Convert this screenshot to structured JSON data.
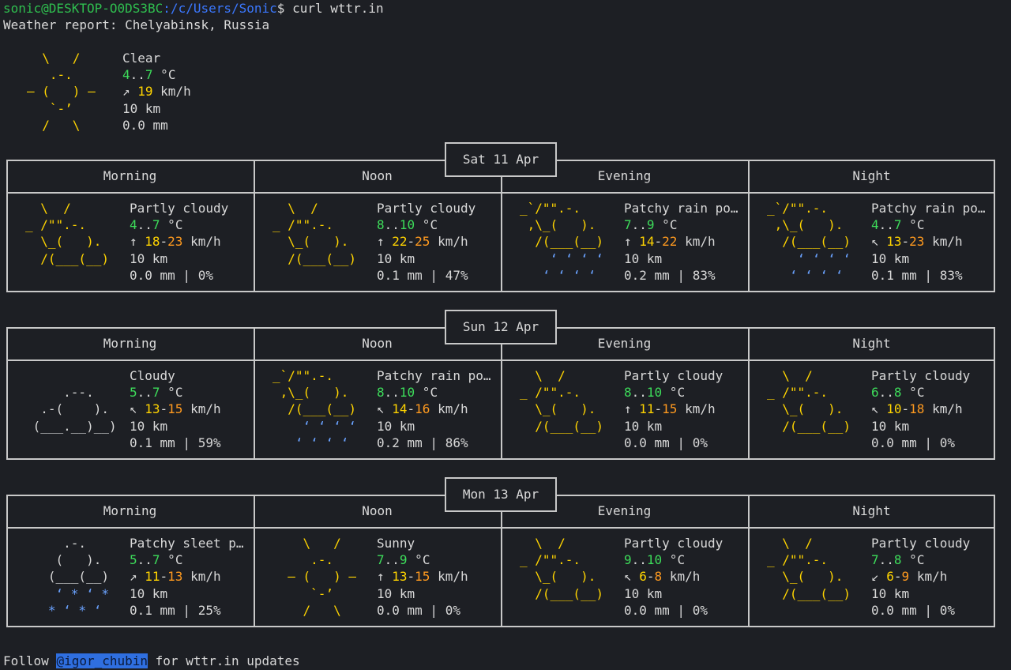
{
  "prompt": {
    "user_host": "sonic@DESKTOP-O0DS3BC",
    "path": ":/c/Users/Sonic",
    "symbol": "$ ",
    "command": "curl wttr.in"
  },
  "report_title": "Weather report: Chelyabinsk, Russia",
  "current": {
    "art": "  \\   /\n   .-.\n― (   ) ―\n   `-’\n  /   \\",
    "condition": "Clear",
    "temp_low": "4",
    "temp_high": "7",
    "temp_unit": " °C",
    "wind_arrow": "↗ ",
    "wind": "19",
    "wind_unit": " km/h",
    "visibility": "10 km",
    "precip": "0.0 mm"
  },
  "columns": [
    "Morning",
    "Noon",
    "Evening",
    "Night"
  ],
  "days": [
    {
      "date": "Sat 11 Apr",
      "periods": [
        {
          "art": "  \\  /\n_ /\"\".-.\n  \\_(   ).\n  /(___(__)",
          "condition": "Partly cloudy",
          "temp_low": "4",
          "temp_high": "7",
          "wind_arrow": "↑ ",
          "wind_low": "18",
          "wind_high": "23",
          "visibility": "10 km",
          "precip": "0.0 mm | 0%"
        },
        {
          "art": "  \\  /\n_ /\"\".-.\n  \\_(   ).\n  /(___(__)",
          "condition": "Partly cloudy",
          "temp_low": "8",
          "temp_high": "10",
          "wind_arrow": "↑ ",
          "wind_low": "22",
          "wind_high": "25",
          "visibility": "10 km",
          "precip": "0.1 mm | 47%"
        },
        {
          "art": "_`/\"\".-.\n ,\\_(   ).\n  /(___(__)\n    ‘ ‘ ‘ ‘\n   ‘ ‘ ‘ ‘",
          "condition": "Patchy rain po…",
          "temp_low": "7",
          "temp_high": "9",
          "wind_arrow": "↑ ",
          "wind_low": "14",
          "wind_high": "22",
          "visibility": "10 km",
          "precip": "0.2 mm | 83%"
        },
        {
          "art": "_`/\"\".-.\n ,\\_(   ).\n  /(___(__)\n    ‘ ‘ ‘ ‘\n   ‘ ‘ ‘ ‘",
          "condition": "Patchy rain po…",
          "temp_low": "4",
          "temp_high": "7",
          "wind_arrow": "↖ ",
          "wind_low": "13",
          "wind_high": "23",
          "visibility": "10 km",
          "precip": "0.1 mm | 83%"
        }
      ]
    },
    {
      "date": "Sun 12 Apr",
      "periods": [
        {
          "art": "\n     .--.\n  .-(    ).\n (___.__)__)",
          "condition": "Cloudy",
          "temp_low": "5",
          "temp_high": "7",
          "wind_arrow": "↖ ",
          "wind_low": "13",
          "wind_high": "15",
          "visibility": "10 km",
          "precip": "0.1 mm | 59%"
        },
        {
          "art": "_`/\"\".-.\n ,\\_(   ).\n  /(___(__)\n    ‘ ‘ ‘ ‘\n   ‘ ‘ ‘ ‘",
          "condition": "Patchy rain po…",
          "temp_low": "8",
          "temp_high": "10",
          "wind_arrow": "↖ ",
          "wind_low": "14",
          "wind_high": "16",
          "visibility": "10 km",
          "precip": "0.2 mm | 86%"
        },
        {
          "art": "  \\  /\n_ /\"\".-.\n  \\_(   ).\n  /(___(__)",
          "condition": "Partly cloudy",
          "temp_low": "8",
          "temp_high": "10",
          "wind_arrow": "↑ ",
          "wind_low": "11",
          "wind_high": "15",
          "visibility": "10 km",
          "precip": "0.0 mm | 0%"
        },
        {
          "art": "  \\  /\n_ /\"\".-.\n  \\_(   ).\n  /(___(__)",
          "condition": "Partly cloudy",
          "temp_low": "6",
          "temp_high": "8",
          "wind_arrow": "↖ ",
          "wind_low": "10",
          "wind_high": "18",
          "visibility": "10 km",
          "precip": "0.0 mm | 0%"
        }
      ]
    },
    {
      "date": "Mon 13 Apr",
      "periods": [
        {
          "art": "     .-.\n    (   ).\n   (___(__)\n    ‘ * ‘ *\n   * ‘ * ‘",
          "condition": "Patchy sleet p…",
          "temp_low": "5",
          "temp_high": "7",
          "wind_arrow": "↗ ",
          "wind_low": "11",
          "wind_high": "13",
          "visibility": "10 km",
          "precip": "0.1 mm | 25%"
        },
        {
          "art": "    \\   /\n     .-.\n  ― (   ) ―\n     `-’\n    /   \\",
          "condition": "Sunny",
          "temp_low": "7",
          "temp_high": "9",
          "wind_arrow": "↑ ",
          "wind_low": "13",
          "wind_high": "15",
          "visibility": "10 km",
          "precip": "0.0 mm | 0%"
        },
        {
          "art": "  \\  /\n_ /\"\".-.\n  \\_(   ).\n  /(___(__)",
          "condition": "Partly cloudy",
          "temp_low": "9",
          "temp_high": "10",
          "wind_arrow": "↖ ",
          "wind_low": "6",
          "wind_high": "8",
          "visibility": "10 km",
          "precip": "0.0 mm | 0%"
        },
        {
          "art": "  \\  /\n_ /\"\".-.\n  \\_(   ).\n  /(___(__)",
          "condition": "Partly cloudy",
          "temp_low": "7",
          "temp_high": "8",
          "wind_arrow": "↙ ",
          "wind_low": "6",
          "wind_high": "9",
          "visibility": "10 km",
          "precip": "0.0 mm | 0%"
        }
      ]
    }
  ],
  "footer": {
    "prefix": "Follow ",
    "handle": "@igor_chubin",
    "suffix": " for wttr.in updates"
  },
  "colors": {
    "background": "#1d1f24",
    "text": "#d9d9d9",
    "user": "#2fbf4f",
    "path": "#3b78ff",
    "sun": "#ffd400",
    "temp": "#3ddc5a",
    "wind_high": "#ff9a1f",
    "rain": "#6aa2ff",
    "highlight": "#2f6fe0"
  }
}
